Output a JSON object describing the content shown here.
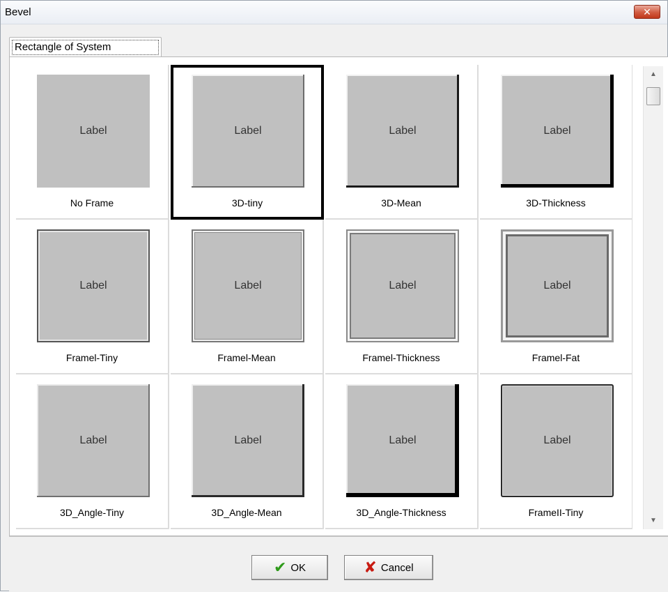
{
  "window": {
    "title": "Bevel",
    "close_symbol": "✕"
  },
  "tab": {
    "label": "Rectangle of System"
  },
  "preview_text": "Label",
  "styles": [
    {
      "name": "No Frame",
      "selected": false
    },
    {
      "name": "3D-tiny",
      "selected": true
    },
    {
      "name": "3D-Mean",
      "selected": false
    },
    {
      "name": "3D-Thickness",
      "selected": false
    },
    {
      "name": "Framel-Tiny",
      "selected": false
    },
    {
      "name": "Framel-Mean",
      "selected": false
    },
    {
      "name": "Framel-Thickness",
      "selected": false
    },
    {
      "name": "Framel-Fat",
      "selected": false
    },
    {
      "name": "3D_Angle-Tiny",
      "selected": false
    },
    {
      "name": "3D_Angle-Mean",
      "selected": false
    },
    {
      "name": "3D_Angle-Thickness",
      "selected": false
    },
    {
      "name": "FrameII-Tiny",
      "selected": false
    }
  ],
  "scrollbar": {
    "up_arrow": "▲",
    "down_arrow": "▼"
  },
  "buttons": {
    "ok_label": "OK",
    "ok_icon": "✔",
    "cancel_label": "Cancel",
    "cancel_icon": "✘"
  }
}
